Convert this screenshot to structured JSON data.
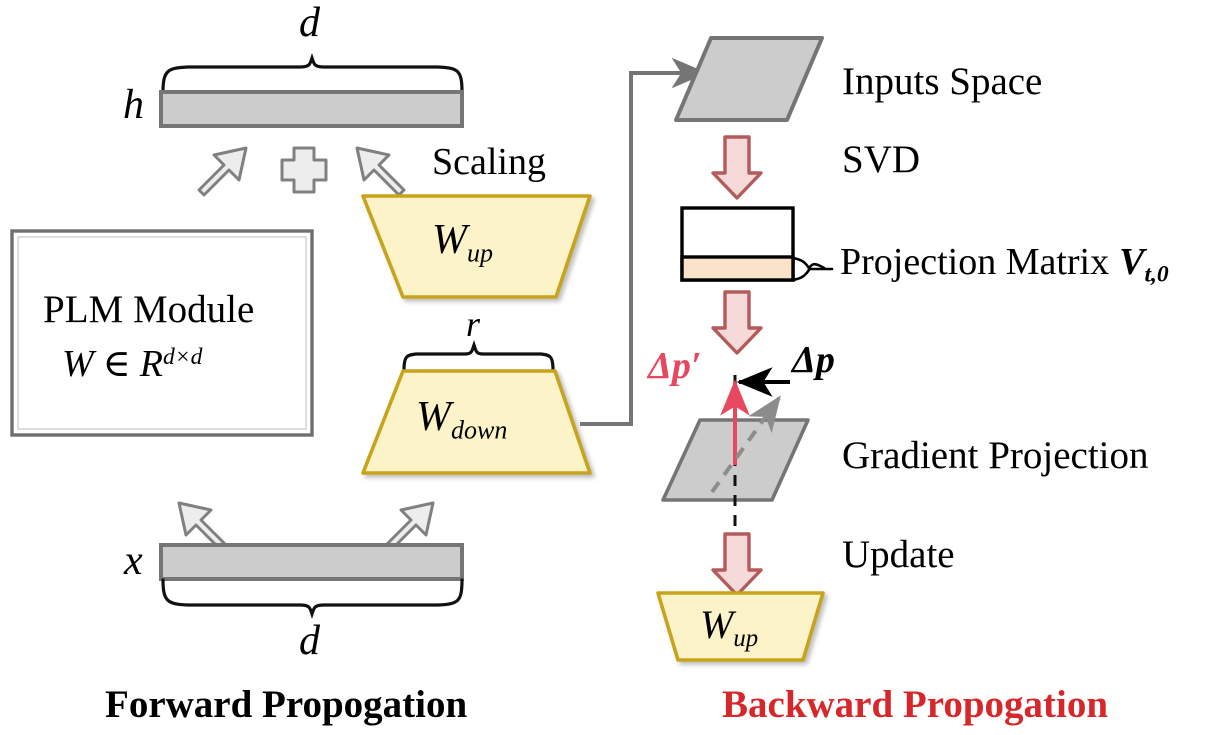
{
  "diagram": {
    "title_left": "Forward Propogation",
    "title_right": "Backward Propogation",
    "title_right_color": "#d8272a"
  },
  "forward": {
    "top_brace_label": "d",
    "bottom_brace_label": "d",
    "rank_brace_label": "r",
    "hidden_vector_label": "h",
    "input_vector_label": "x",
    "scaling_label": "Scaling",
    "plus_symbol": "+",
    "plm_title": "PLM Module",
    "plm_formula_w": "W",
    "plm_formula_in": "∈",
    "plm_formula_r": "R",
    "plm_formula_exp": "d×d",
    "w_up_base": "W",
    "w_up_sub": "up",
    "w_down_base": "W",
    "w_down_sub": "down"
  },
  "backward": {
    "inputs_space_label": "Inputs Space",
    "svd_label": "SVD",
    "projection_matrix_label": "Projection Matrix",
    "projection_matrix_symbol": "V",
    "projection_matrix_sub": "t,0",
    "gradient_projection_label": "Gradient Projection",
    "update_label": "Update",
    "delta_p_prime_label": "Δp′",
    "delta_p_label": "Δp",
    "w_up_base": "W",
    "w_up_sub": "up"
  },
  "colors": {
    "gray_fill": "#cccccc",
    "gray_stroke": "#757575",
    "yellow_fill": "#fdf3c8",
    "yellow_stroke": "#c8a31a",
    "pink_fill": "#f6dada",
    "pink_stroke": "#b35b5b",
    "peach_fill": "#fbe3ca",
    "red_accent": "#e8485f",
    "red_title": "#d8272a",
    "arrow_fill": "#ededed",
    "arrow_stroke": "#808080",
    "box_stroke": "#6e6e6e"
  }
}
